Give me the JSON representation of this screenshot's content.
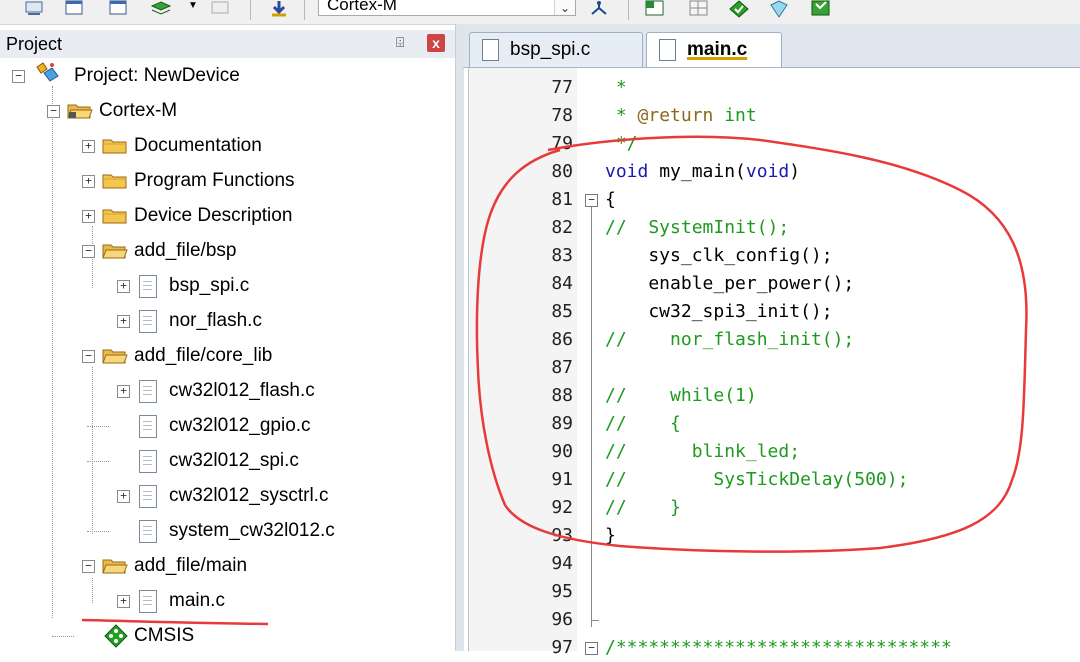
{
  "toolbar": {
    "target": "Cortex-M"
  },
  "project_panel": {
    "title": "Project",
    "pin_glyph": "⌹",
    "close_glyph": "x",
    "tree": [
      {
        "label": "Project: NewDevice",
        "icon": "project-icon",
        "expander": "−"
      },
      {
        "label": "Cortex-M",
        "icon": "target-folder-icon",
        "expander": "−"
      },
      {
        "label": "Documentation",
        "icon": "folder-icon",
        "expander": "+"
      },
      {
        "label": "Program Functions",
        "icon": "folder-icon",
        "expander": "+"
      },
      {
        "label": "Device Description",
        "icon": "folder-icon",
        "expander": "+"
      },
      {
        "label": "add_file/bsp",
        "icon": "open-folder-icon",
        "expander": "−"
      },
      {
        "label": "bsp_spi.c",
        "icon": "file-icon",
        "expander": "+"
      },
      {
        "label": "nor_flash.c",
        "icon": "file-icon",
        "expander": "+"
      },
      {
        "label": "add_file/core_lib",
        "icon": "open-folder-icon",
        "expander": "−"
      },
      {
        "label": "cw32l012_flash.c",
        "icon": "file-icon",
        "expander": "+"
      },
      {
        "label": "cw32l012_gpio.c",
        "icon": "file-icon",
        "expander": ""
      },
      {
        "label": "cw32l012_spi.c",
        "icon": "file-icon",
        "expander": ""
      },
      {
        "label": "cw32l012_sysctrl.c",
        "icon": "file-icon",
        "expander": "+"
      },
      {
        "label": "system_cw32l012.c",
        "icon": "file-icon",
        "expander": ""
      },
      {
        "label": "add_file/main",
        "icon": "open-folder-icon",
        "expander": "−"
      },
      {
        "label": "main.c",
        "icon": "file-icon",
        "expander": "+"
      },
      {
        "label": "CMSIS",
        "icon": "cmsis-gem-icon",
        "expander": ""
      }
    ]
  },
  "tabs": [
    {
      "label": "bsp_spi.c",
      "active": false
    },
    {
      "label": "main.c",
      "active": true
    }
  ],
  "editor": {
    "fold_open": "−",
    "lines": [
      {
        "n": "77",
        "parts": [
          {
            "t": " *",
            "c": "green"
          }
        ]
      },
      {
        "n": "78",
        "parts": [
          {
            "t": " * ",
            "c": "green"
          },
          {
            "t": "@return",
            "c": "brown"
          },
          {
            "t": " int",
            "c": "green"
          }
        ]
      },
      {
        "n": "79",
        "parts": [
          {
            "t": " */",
            "c": "green"
          }
        ]
      },
      {
        "n": "80",
        "parts": [
          {
            "t": "void",
            "c": "blue"
          },
          {
            "t": " my_main(",
            "c": "black"
          },
          {
            "t": "void",
            "c": "blue"
          },
          {
            "t": ")",
            "c": "black"
          }
        ]
      },
      {
        "n": "81",
        "parts": [
          {
            "t": "{",
            "c": "black"
          }
        ]
      },
      {
        "n": "82",
        "parts": [
          {
            "t": "//  SystemInit();",
            "c": "green"
          }
        ]
      },
      {
        "n": "83",
        "parts": [
          {
            "t": "    sys_clk_config();",
            "c": "black"
          }
        ]
      },
      {
        "n": "84",
        "parts": [
          {
            "t": "    enable_per_power();",
            "c": "black"
          }
        ]
      },
      {
        "n": "85",
        "parts": [
          {
            "t": "    cw32_spi3_init();",
            "c": "black"
          }
        ]
      },
      {
        "n": "86",
        "parts": [
          {
            "t": "//    nor_flash_init();",
            "c": "green"
          }
        ]
      },
      {
        "n": "87",
        "parts": [
          {
            "t": "",
            "c": "black"
          }
        ]
      },
      {
        "n": "88",
        "parts": [
          {
            "t": "//    while(1)",
            "c": "green"
          }
        ]
      },
      {
        "n": "89",
        "parts": [
          {
            "t": "//    {",
            "c": "green"
          }
        ]
      },
      {
        "n": "90",
        "parts": [
          {
            "t": "//      blink_led;",
            "c": "green"
          }
        ]
      },
      {
        "n": "91",
        "parts": [
          {
            "t": "//        SysTickDelay(500);",
            "c": "green"
          }
        ]
      },
      {
        "n": "92",
        "parts": [
          {
            "t": "//    }",
            "c": "green"
          }
        ]
      },
      {
        "n": "93",
        "parts": [
          {
            "t": "}",
            "c": "black"
          }
        ]
      },
      {
        "n": "94",
        "parts": [
          {
            "t": "",
            "c": "black"
          }
        ]
      },
      {
        "n": "95",
        "parts": [
          {
            "t": "",
            "c": "black"
          }
        ]
      },
      {
        "n": "96",
        "parts": [
          {
            "t": "",
            "c": "black"
          }
        ]
      },
      {
        "n": "97",
        "parts": [
          {
            "t": "/*******************************",
            "c": "green"
          }
        ]
      }
    ]
  },
  "annotation_color": "#e8393b"
}
